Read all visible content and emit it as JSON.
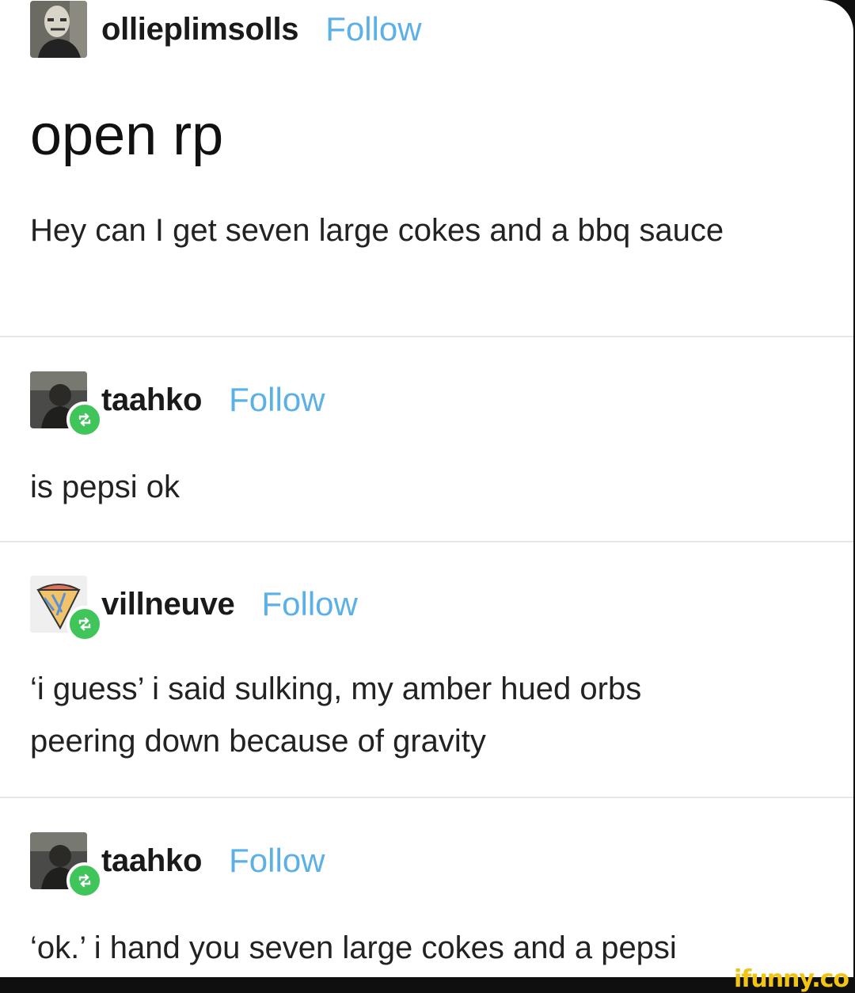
{
  "posts": [
    {
      "username": "ollieplimsolls",
      "follow_label": "Follow",
      "title": "open rp",
      "text": "Hey can I get seven large cokes and a bbq sauce",
      "avatar_icon": "masked-face-avatar"
    },
    {
      "username": "taahko",
      "follow_label": "Follow",
      "text": "is pepsi ok",
      "avatar_icon": "person-photo-avatar",
      "reblog_icon": "reblog-icon"
    },
    {
      "username": "villneuve",
      "follow_label": "Follow",
      "text_line1": "‘i guess’ i said sulking, my amber hued orbs",
      "text_line2": "peering down because of gravity",
      "avatar_icon": "ice-cream-cone-avatar",
      "reblog_icon": "reblog-icon"
    },
    {
      "username": "taahko",
      "follow_label": "Follow",
      "text": "‘ok.’ i hand you seven large cokes and a pepsi",
      "avatar_icon": "person-photo-avatar",
      "reblog_icon": "reblog-icon"
    }
  ],
  "watermark": "ifunny.co",
  "colors": {
    "follow": "#5bb0e6",
    "reblog_badge": "#3fc55a",
    "watermark": "#f2c415",
    "divider": "#e6e6e6"
  }
}
